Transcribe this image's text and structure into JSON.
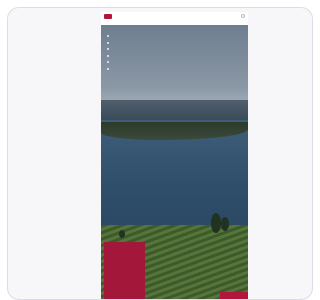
{
  "header": {
    "brand": "",
    "subbrand": ""
  },
  "menu": {
    "items": [
      {
        "label": ""
      },
      {
        "label": ""
      },
      {
        "label": ""
      },
      {
        "label": ""
      },
      {
        "label": ""
      },
      {
        "label": ""
      }
    ]
  },
  "info": {
    "text": "",
    "link_label": ""
  },
  "cta": {
    "label": ""
  },
  "colors": {
    "brand": "#b0173b",
    "info_box": "#a3173a"
  }
}
